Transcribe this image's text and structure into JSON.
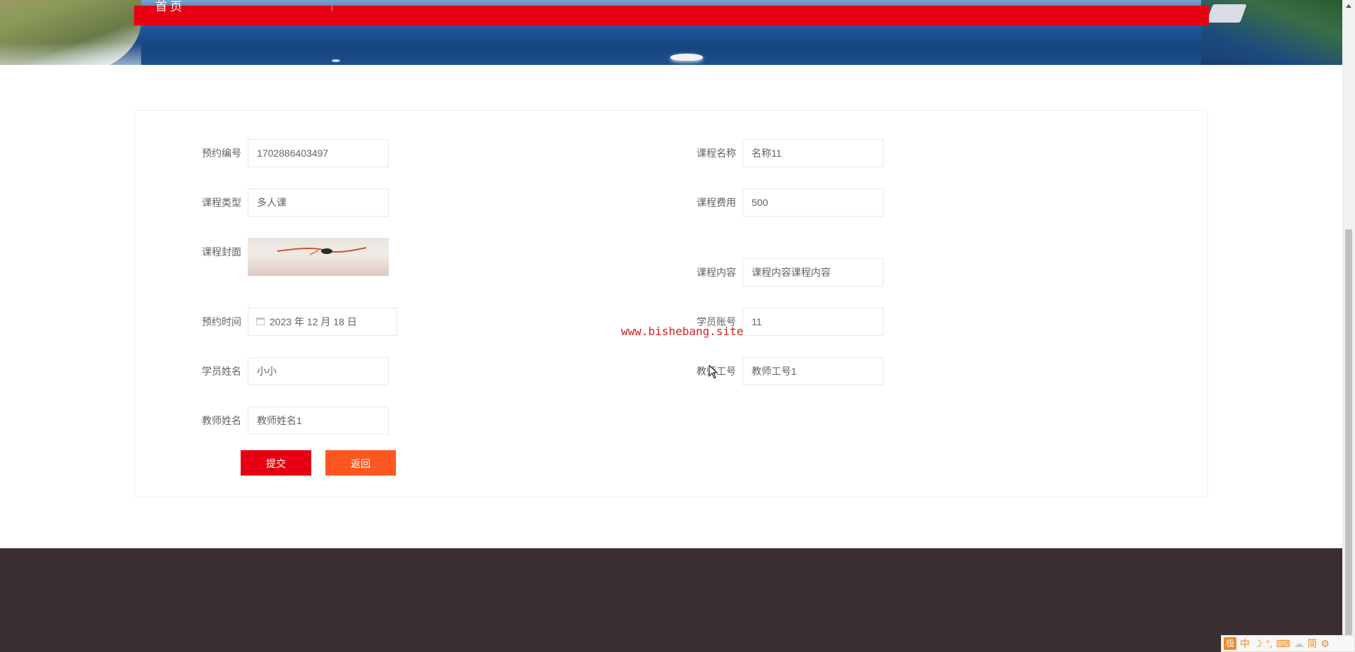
{
  "nav": {
    "home": "首页"
  },
  "form": {
    "booking_no_label": "预约编号",
    "booking_no_value": "1702886403497",
    "course_name_label": "课程名称",
    "course_name_value": "名称11",
    "course_type_label": "课程类型",
    "course_type_value": "多人课",
    "course_fee_label": "课程费用",
    "course_fee_value": "500",
    "cover_label": "课程封面",
    "content_label": "课程内容",
    "content_value": "课程内容课程内容",
    "booking_time_label": "预约时间",
    "booking_time_value": "2023 年 12 月 18 日",
    "student_account_label": "学员账号",
    "student_account_value": "11",
    "student_name_label": "学员姓名",
    "student_name_value": "小小",
    "teacher_no_label": "教师工号",
    "teacher_no_value": "教师工号1",
    "teacher_name_label": "教师姓名",
    "teacher_name_value": "教师姓名1"
  },
  "buttons": {
    "submit": "提交",
    "back": "返回"
  },
  "watermark": "www.bishebang.site",
  "ime": {
    "logo": "极",
    "chinese": "中",
    "moon": "☽",
    "simplified": "简",
    "gear": "⚙"
  },
  "colors": {
    "accent_red": "#e60012",
    "back_orange": "#ff5722",
    "footer": "#3b2e31"
  }
}
